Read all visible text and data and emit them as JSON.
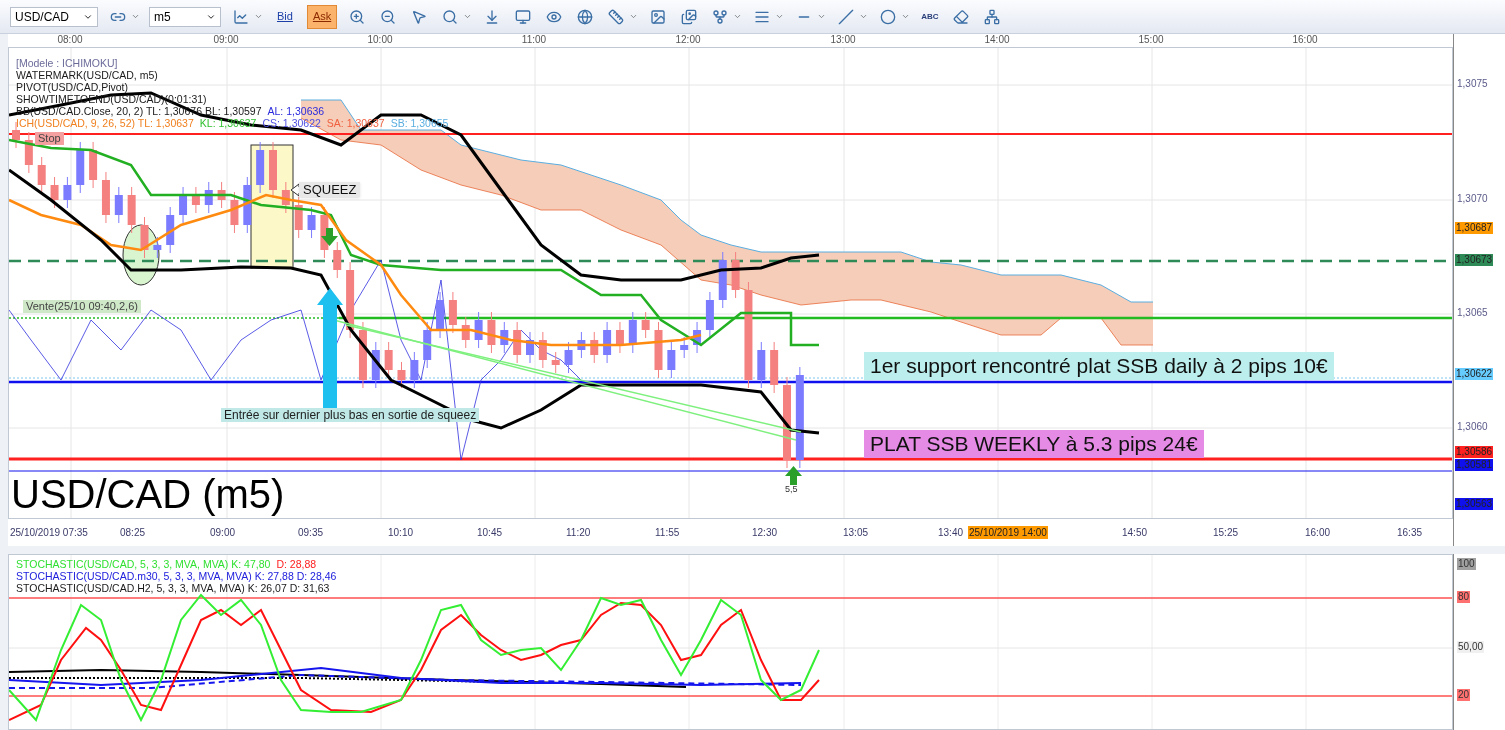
{
  "toolbar": {
    "symbol": "USD/CAD",
    "timeframe": "m5",
    "price_buttons": [
      {
        "label": "Bid",
        "selected": false
      },
      {
        "label": "Ask",
        "selected": true
      }
    ],
    "text_tool": "ABC"
  },
  "chart": {
    "time_labels_top": [
      "08:00",
      "09:00",
      "10:00",
      "11:00",
      "12:00",
      "13:00",
      "14:00",
      "15:00",
      "16:00"
    ],
    "legend": [
      {
        "parts": [
          {
            "text": "[Modele : ICHIMOKU]",
            "color": "#6b6b9a"
          }
        ]
      },
      {
        "parts": [
          {
            "text": "WATERMARK(USD/CAD, m5)",
            "color": "#1a1a1a"
          }
        ]
      },
      {
        "parts": [
          {
            "text": "PIVOT(USD/CAD,Pivot)",
            "color": "#1a1a1a"
          }
        ]
      },
      {
        "parts": [
          {
            "text": "SHOWTIMETOEND(USD/CAD)(0:01:31)",
            "color": "#1a1a1a"
          }
        ]
      },
      {
        "parts": [
          {
            "text": "BB(USD/CAD.Close, 20, 2)  TL: 1,30676  BL: 1,30597",
            "color": "#1a1a1a"
          },
          {
            "text": "AL: 1,30636",
            "color": "#2b2bdd"
          }
        ]
      },
      {
        "parts": [
          {
            "text": "ICH(USD/CAD, 9, 26, 52)  TL: 1,30637",
            "color": "#f08020"
          },
          {
            "text": "KL: 1,30637",
            "color": "#30c030"
          },
          {
            "text": "CS: 1,30622",
            "color": "#5050e0"
          },
          {
            "text": "SA: 1,30637",
            "color": "#f06040"
          },
          {
            "text": "SB: 1,30655",
            "color": "#5aaee0"
          }
        ]
      }
    ],
    "annotations": [
      {
        "kind": "stop",
        "text": "Stop"
      },
      {
        "kind": "signal",
        "text": "Vente(25/10 09:40,2,6)"
      },
      {
        "kind": "callout",
        "text": "SQUEEZ"
      },
      {
        "kind": "note",
        "text": "Entrée sur dernier plus bas en sortie de squeez"
      },
      {
        "kind": "support",
        "text": "1er support rencontré plat SSB daily à 2 pips 10€"
      },
      {
        "kind": "target",
        "text": "PLAT SSB WEEKLY à 5.3 pips 24€"
      },
      {
        "kind": "mark",
        "text": "5,5"
      }
    ],
    "watermark": "USD/CAD (m5)",
    "price_ticks": [
      "1,3075",
      "1,3070",
      "1,3065",
      "1,3060"
    ],
    "price_badges": [
      {
        "text": "1,30687",
        "color": "#ff9900"
      },
      {
        "text": "1,30673",
        "color": "#2e8b57"
      },
      {
        "text": "1,30622",
        "color": "#66ccff"
      },
      {
        "text": "1,30586",
        "color": "#ff2020"
      },
      {
        "text": "1,30581",
        "color": "#1010ee"
      },
      {
        "text": "1,30563",
        "color": "#1010ee"
      }
    ],
    "time_labels_bottom": [
      "25/10/2019 07:35",
      "08:25",
      "09:00",
      "09:35",
      "10:10",
      "10:45",
      "11:20",
      "11:55",
      "12:30",
      "13:05",
      "13:40",
      "14:50",
      "15:25",
      "16:00",
      "16:35"
    ],
    "cursor_time": "25/10/2019 14:00"
  },
  "stochastic": {
    "legend": [
      {
        "parts": [
          {
            "text": "STOCHASTIC(USD/CAD, 5, 3, 3, MVA, MVA)  K: 47,80",
            "color": "#30e030"
          },
          {
            "text": "D: 28,88",
            "color": "#ff2020"
          }
        ]
      },
      {
        "parts": [
          {
            "text": "STOCHASTIC(USD/CAD.m30, 5, 3, 3, MVA, MVA)  K: 27,88  D: 28,46",
            "color": "#2020dd"
          }
        ]
      },
      {
        "parts": [
          {
            "text": "STOCHASTIC(USD/CAD.H2, 5, 3, 3, MVA, MVA)  K: 26,07  D: 31,63",
            "color": "#1a1a1a"
          }
        ]
      }
    ],
    "ticks": [
      {
        "text": "100",
        "color": "#a0a0a0"
      },
      {
        "text": "80",
        "color": "#ff7070"
      },
      {
        "text": "50,00",
        "color": "#f0f0f0"
      },
      {
        "text": "20",
        "color": "#ff7070"
      }
    ]
  }
}
